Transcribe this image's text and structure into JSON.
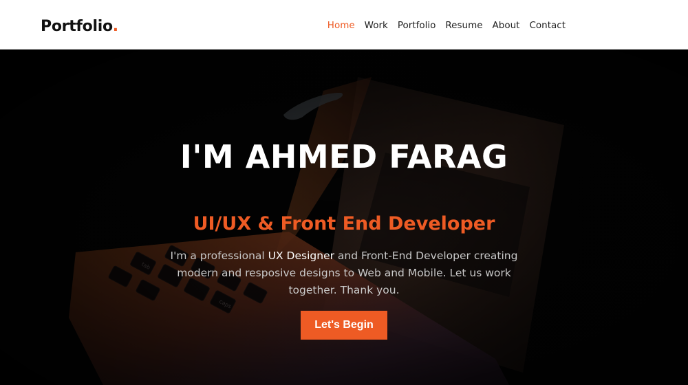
{
  "colors": {
    "accent": "#ee5b24",
    "nav_bg": "#ffffff",
    "hero_text": "#ffffff"
  },
  "brand": {
    "name": "Portfolio",
    "dot": "."
  },
  "nav": {
    "items": [
      {
        "label": "Home",
        "active": true
      },
      {
        "label": "Work",
        "active": false
      },
      {
        "label": "Portfolio",
        "active": false
      },
      {
        "label": "Resume",
        "active": false
      },
      {
        "label": "About",
        "active": false
      },
      {
        "label": "Contact",
        "active": false
      }
    ]
  },
  "hero": {
    "title": "I'M AHMED FARAG",
    "subtitle": "UI/UX & Front End Developer",
    "description_before": "I'm a professional ",
    "description_highlight": "UX Designer",
    "description_after": " and Front-End Developer creating modern and resposive designs to Web and Mobile. Let us work together. Thank you.",
    "cta_label": "Let's Begin",
    "background": "laptop-keyboard-photo",
    "keyboard_keys": [
      "tab",
      "caps"
    ]
  }
}
